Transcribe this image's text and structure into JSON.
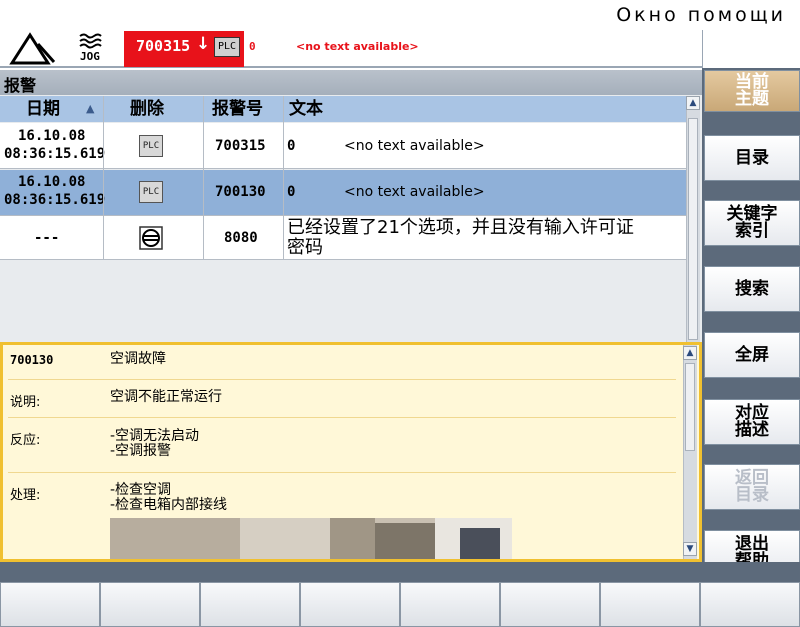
{
  "window": {
    "title": "Окно помощи"
  },
  "header": {
    "mode_label": "JOG",
    "alarm": {
      "number": "700315",
      "source": "PLC",
      "value": "0",
      "message": "<no text available>"
    }
  },
  "main": {
    "title": "报警"
  },
  "table": {
    "columns": [
      "日期",
      "删除",
      "报警号",
      "文本"
    ],
    "sort_indicator": "▲",
    "rows": [
      {
        "date": "16.10.08",
        "time": "08:36:15.619",
        "delete": "PLC",
        "number": "700315",
        "value": "0",
        "text": "<no text available>"
      },
      {
        "date": "16.10.08",
        "time": "08:36:15.619",
        "delete": "PLC",
        "number": "700130",
        "value": "0",
        "text": "<no text available>"
      },
      {
        "date": "---",
        "time": "",
        "delete": "",
        "number": "8080",
        "value": "",
        "text": "已经设置了21个选项，并且没有输入许可证\n密码"
      }
    ]
  },
  "help": {
    "alarm_number": "700130",
    "alarm_title": "空调故障",
    "items": [
      {
        "label": "说明:",
        "value": "空调不能正常运行"
      },
      {
        "label": "反应:",
        "value": "-空调无法启动\n-空调报警"
      },
      {
        "label": "处理:",
        "value": "-检查空调\n-检查电箱内部接线"
      }
    ]
  },
  "softkeys": [
    {
      "label": "当前\n主题",
      "state": "active"
    },
    {
      "label": "目录",
      "state": "normal"
    },
    {
      "label": "关键字\n索引",
      "state": "normal"
    },
    {
      "label": "搜索",
      "state": "normal"
    },
    {
      "label": "全屏",
      "state": "normal"
    },
    {
      "label": "对应\n描述",
      "state": "normal"
    },
    {
      "label": "返回\n目录",
      "state": "disabled"
    },
    {
      "label": "退出\n帮助",
      "state": "normal"
    }
  ],
  "colors": {
    "alarm_red": "#e8121a",
    "header_blue": "#a9c4e4",
    "selected_row": "#8fb0d8",
    "help_border": "#f0c030",
    "panel_gray": "#5c6a7b"
  }
}
